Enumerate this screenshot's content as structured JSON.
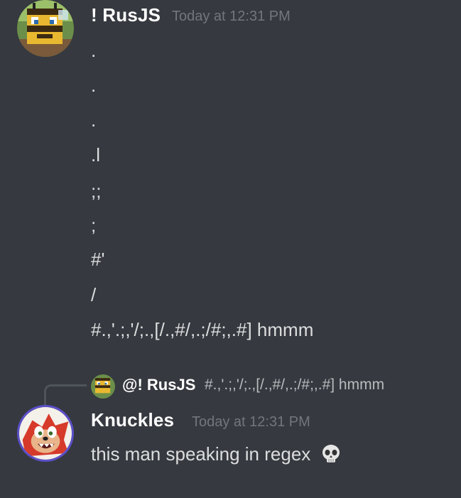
{
  "messages": [
    {
      "author": "! RusJS",
      "timestamp": "Today at 12:31 PM",
      "avatar_icon": "bee-avatar-icon",
      "lines": [
        ".",
        ".",
        ".",
        ".l",
        ";;",
        ";",
        "#'",
        "/",
        "#.,'.;,'/;.,[/.,#/,.;/#;,.#] hmmm"
      ]
    },
    {
      "reply": {
        "mention": "@! RusJS",
        "text": "#.,'.;,'/;.,[/.,#/,.;/#;,.#] hmmm",
        "avatar_icon": "bee-avatar-icon"
      },
      "author": "Knuckles",
      "timestamp": "Today at 12:31 PM",
      "avatar_icon": "knuckles-avatar-icon",
      "text": "this man speaking in regex",
      "emoji": "skull-emoji-icon"
    }
  ],
  "colors": {
    "background": "#36393f",
    "username": "#ffffff",
    "timestamp": "#72767d",
    "text": "#dcddde",
    "reply_spine": "#4f545c"
  }
}
